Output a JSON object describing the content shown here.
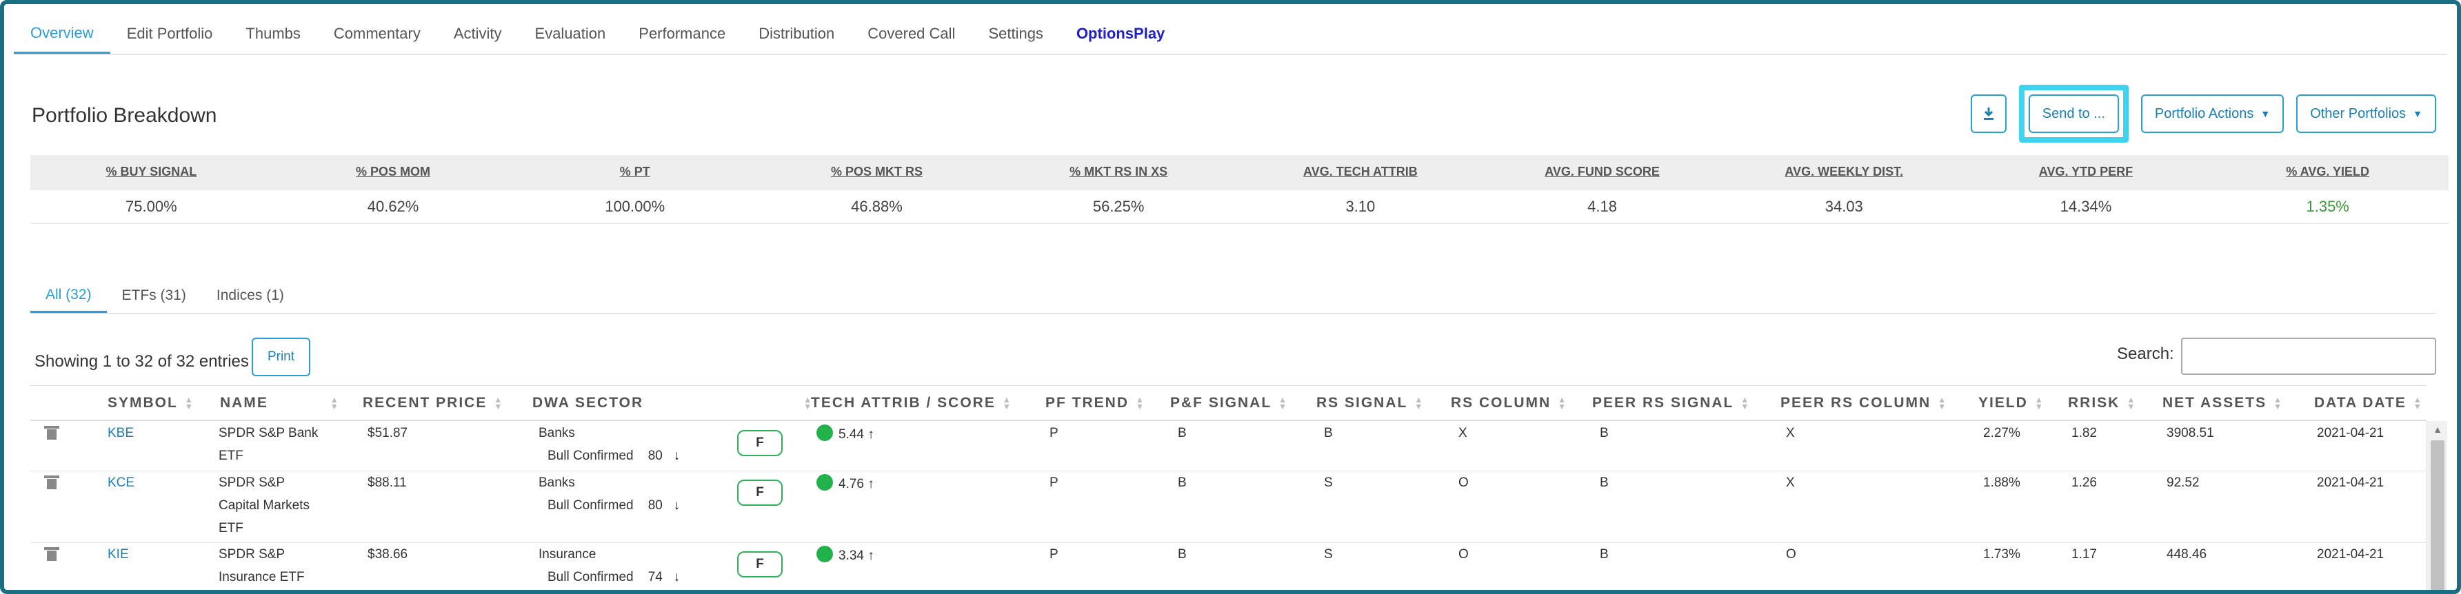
{
  "nav": {
    "tabs": [
      "Overview",
      "Edit Portfolio",
      "Thumbs",
      "Commentary",
      "Activity",
      "Evaluation",
      "Performance",
      "Distribution",
      "Covered Call",
      "Settings",
      "OptionsPlay"
    ],
    "active_index": 0
  },
  "header": {
    "title": "Portfolio Breakdown",
    "download_icon": "download-icon",
    "send_to_label": "Send to ...",
    "portfolio_actions_label": "Portfolio Actions",
    "other_portfolios_label": "Other Portfolios"
  },
  "summary": {
    "headers": [
      "% BUY SIGNAL",
      "% POS MOM",
      "% PT",
      "% POS MKT RS",
      "% MKT RS IN XS",
      "AVG. TECH ATTRIB",
      "AVG. FUND SCORE",
      "AVG. WEEKLY DIST.",
      "AVG. YTD PERF",
      "% AVG. YIELD"
    ],
    "values": [
      "75.00%",
      "40.62%",
      "100.00%",
      "46.88%",
      "56.25%",
      "3.10",
      "4.18",
      "34.03",
      "14.34%",
      "1.35%"
    ],
    "yield_color": "#3a9a3a"
  },
  "subtabs": [
    "All (32)",
    "ETFs (31)",
    "Indices (1)"
  ],
  "table": {
    "showing": "Showing 1 to 32 of 32 entries",
    "print_label": "Print",
    "search_label": "Search:",
    "search_value": "",
    "columns": [
      "SYMBOL",
      "NAME",
      "RECENT PRICE",
      "DWA SECTOR",
      "TECH ATTRIB / SCORE",
      "PF TREND",
      "P&F SIGNAL",
      "RS SIGNAL",
      "RS COLUMN",
      "PEER RS SIGNAL",
      "PEER RS COLUMN",
      "YIELD",
      "RRISK",
      "NET ASSETS",
      "DATA DATE"
    ],
    "rows": [
      {
        "symbol": "KBE",
        "name_lines": [
          "SPDR S&P Bank",
          "ETF"
        ],
        "price": "$51.87",
        "sector": "Banks",
        "sector_status": "Bull Confirmed",
        "sector_score": "80",
        "sector_arrow": "↓",
        "fund_badge": "F",
        "tech_score": "5.44",
        "tech_arrow": "↑",
        "pf_trend": "P",
        "pf_signal": "B",
        "rs_signal": "B",
        "rs_column": "X",
        "peer_rs_signal": "B",
        "peer_rs_column": "X",
        "yield": "2.27%",
        "rrisk": "1.82",
        "net_assets": "3908.51",
        "data_date": "2021-04-21"
      },
      {
        "symbol": "KCE",
        "name_lines": [
          "SPDR S&P",
          "Capital Markets",
          "ETF"
        ],
        "price": "$88.11",
        "sector": "Banks",
        "sector_status": "Bull Confirmed",
        "sector_score": "80",
        "sector_arrow": "↓",
        "fund_badge": "F",
        "tech_score": "4.76",
        "tech_arrow": "↑",
        "pf_trend": "P",
        "pf_signal": "B",
        "rs_signal": "S",
        "rs_column": "O",
        "peer_rs_signal": "B",
        "peer_rs_column": "X",
        "yield": "1.88%",
        "rrisk": "1.26",
        "net_assets": "92.52",
        "data_date": "2021-04-21"
      },
      {
        "symbol": "KIE",
        "name_lines": [
          "SPDR S&P",
          "Insurance ETF"
        ],
        "price": "$38.66",
        "sector": "Insurance",
        "sector_status": "Bull Confirmed",
        "sector_score": "74",
        "sector_arrow": "↓",
        "fund_badge": "F",
        "tech_score": "3.34",
        "tech_arrow": "↑",
        "pf_trend": "P",
        "pf_signal": "B",
        "rs_signal": "S",
        "rs_column": "O",
        "peer_rs_signal": "B",
        "peer_rs_column": "O",
        "yield": "1.73%",
        "rrisk": "1.17",
        "net_assets": "448.46",
        "data_date": "2021-04-21"
      }
    ]
  },
  "colors": {
    "accent": "#2a9fd6",
    "highlight": "#3fd3f0",
    "frame": "#1a6f82",
    "tech_dot": "#22b24c",
    "badge_border": "#2bb35a"
  }
}
